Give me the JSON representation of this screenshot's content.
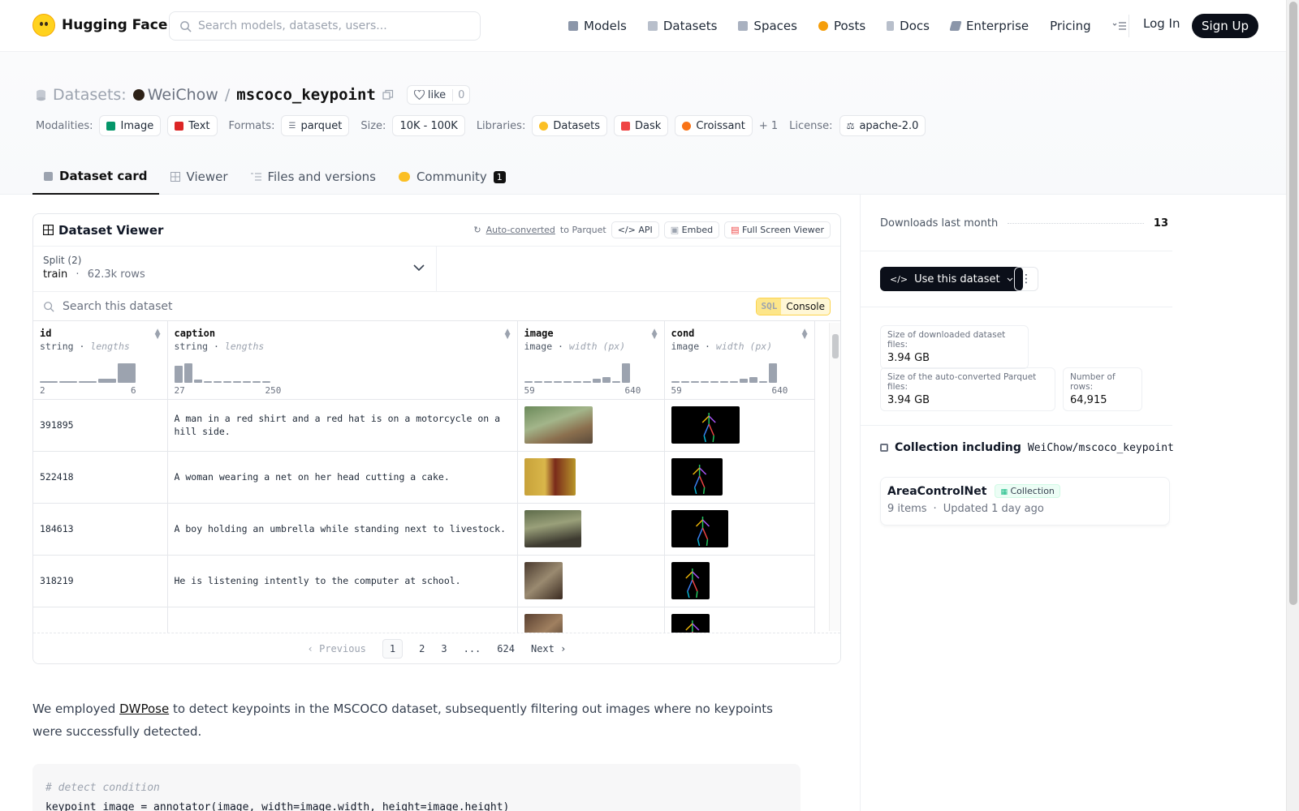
{
  "header": {
    "brand": "Hugging Face",
    "search_placeholder": "Search models, datasets, users...",
    "nav": [
      {
        "label": "Models",
        "color": "#8b96a9"
      },
      {
        "label": "Datasets",
        "color": "#b8bfcb"
      },
      {
        "label": "Spaces",
        "color": "#a9b1c0"
      },
      {
        "label": "Posts",
        "color": "#f59e0b"
      },
      {
        "label": "Docs",
        "color": "#b8bfcb"
      },
      {
        "label": "Enterprise",
        "color": "#8b96a9"
      },
      {
        "label": "Pricing",
        "color": ""
      }
    ],
    "login": "Log In",
    "signup": "Sign Up"
  },
  "repo": {
    "type_label": "Datasets:",
    "owner": "WeiChow",
    "separator": "/",
    "name": "mscoco_keypoint",
    "like_label": "like",
    "like_count": "0",
    "modalities_label": "Modalities:",
    "modalities": [
      {
        "label": "Image",
        "color": "#059669"
      },
      {
        "label": "Text",
        "color": "#dc2626"
      }
    ],
    "formats_label": "Formats:",
    "format": "parquet",
    "size_label": "Size:",
    "size": "10K - 100K",
    "libraries_label": "Libraries:",
    "libraries": [
      {
        "label": "Datasets",
        "color": "#fbbf24"
      },
      {
        "label": "Dask",
        "color": "#ef4444"
      },
      {
        "label": "Croissant",
        "color": "#f97316"
      }
    ],
    "libraries_more": "+ 1",
    "license_label": "License:",
    "license": "apache-2.0"
  },
  "tabs": [
    {
      "label": "Dataset card",
      "active": true
    },
    {
      "label": "Viewer"
    },
    {
      "label": "Files and versions"
    },
    {
      "label": "Community",
      "badge": "1"
    }
  ],
  "viewer": {
    "title": "Dataset Viewer",
    "auto_converted": "Auto-converted",
    "to_parquet": "to Parquet",
    "api": "API",
    "embed": "Embed",
    "fullscreen": "Full Screen Viewer",
    "split_label": "Split (2)",
    "split_value": "train",
    "split_dot": "·",
    "split_rows": "62.3k rows",
    "search_placeholder": "Search this dataset",
    "sql": "SQL",
    "console": "Console",
    "columns": [
      {
        "name": "id",
        "type": "string",
        "stat": "lengths",
        "min": "2",
        "max": "6",
        "hist": [
          0.05,
          0.05,
          0.05,
          0.15,
          0.85
        ]
      },
      {
        "name": "caption",
        "type": "string",
        "stat": "lengths",
        "min": "27",
        "max": "250",
        "hist": [
          0.75,
          0.85,
          0.12,
          0.05,
          0.05,
          0.05,
          0.05,
          0.05,
          0.05,
          0.05
        ]
      },
      {
        "name": "image",
        "type": "image",
        "stat": "width (px)",
        "min": "59",
        "max": "640",
        "hist": [
          0.05,
          0.05,
          0.05,
          0.05,
          0.05,
          0.05,
          0.05,
          0.15,
          0.25,
          0.05,
          0.85
        ]
      },
      {
        "name": "cond",
        "type": "image",
        "stat": "width (px)",
        "min": "59",
        "max": "640",
        "hist": [
          0.05,
          0.05,
          0.05,
          0.05,
          0.05,
          0.05,
          0.05,
          0.15,
          0.25,
          0.05,
          0.85
        ]
      }
    ],
    "rows": [
      {
        "id": "391895",
        "caption": "A man in a red shirt and a red hat is on a motorcycle on a hill side.",
        "img_w": 84,
        "img_h": 46
      },
      {
        "id": "522418",
        "caption": "A woman wearing a net on her head cutting a cake.",
        "img_w": 63,
        "img_h": 46
      },
      {
        "id": "184613",
        "caption": "A boy holding an umbrella while standing next to livestock.",
        "img_w": 70,
        "img_h": 46
      },
      {
        "id": "318219",
        "caption": "He is listening intently to the computer at school.",
        "img_w": 47,
        "img_h": 46
      },
      {
        "id": "",
        "caption": "",
        "img_w": 47,
        "img_h": 46
      }
    ],
    "pager": {
      "prev": "Previous",
      "pages": [
        "1",
        "2",
        "3",
        "...",
        "624"
      ],
      "next": "Next",
      "current": "1"
    }
  },
  "card": {
    "text_before": "We employed ",
    "link": "DWPose",
    "text_after": " to detect keypoints in the MSCOCO dataset, subsequently filtering out images where no keypoints were successfully detected.",
    "code_comment": "# detect condition",
    "code_line": "keypoint_image = annotator(image, width=image.width, height=image.height)"
  },
  "sidebar": {
    "downloads_label": "Downloads last month",
    "downloads": "13",
    "use_dataset": "Use this dataset",
    "size_dl_label": "Size of downloaded dataset files:",
    "size_dl": "3.94 GB",
    "size_parquet_label": "Size of the auto-converted Parquet files:",
    "size_parquet": "3.94 GB",
    "rows_label": "Number of rows:",
    "rows": "64,915",
    "collection_heading": "Collection including",
    "collection_repo": "WeiChow/mscoco_keypoint",
    "collection_name": "AreaControlNet",
    "collection_badge": "Collection",
    "collection_items": "9 items",
    "collection_dot": "·",
    "collection_updated": "Updated 1 day ago"
  }
}
